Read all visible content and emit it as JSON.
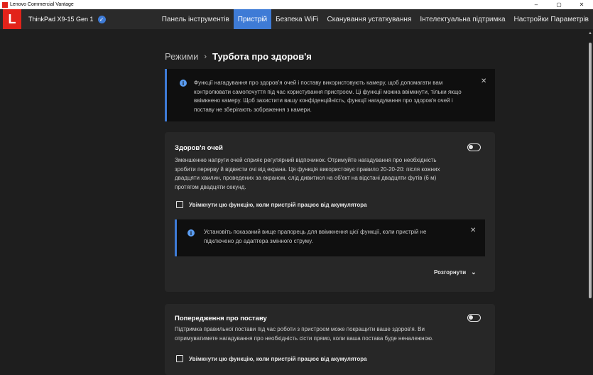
{
  "window": {
    "title": "Lenovo Commercial Vantage",
    "minimize": "–",
    "maximize": "▢",
    "close": "✕"
  },
  "appbar": {
    "logo": "L",
    "device_name": "ThinkPad X9-15 Gen 1",
    "verified": "✓",
    "tabs": [
      {
        "label": "Панель інструментів"
      },
      {
        "label": "Пристрій"
      },
      {
        "label": "Безпека WiFi"
      },
      {
        "label": "Сканування устаткування"
      },
      {
        "label": "Інтелектуальна підтримка"
      },
      {
        "label": "Настройки Параметрів"
      }
    ],
    "active_tab": "Пристрій"
  },
  "breadcrumb": {
    "parent": "Режими",
    "separator": "›",
    "current": "Турбота про здоров'я"
  },
  "notice": {
    "icon": "info-icon",
    "text": "Функції нагадування про здоров'я очей і поставу використовують камеру, щоб допомагати вам контролювати самопочуття під час користування пристроєм. Ці функції можна ввімкнути, тільки якщо ввімкнено камеру. Щоб захистити вашу конфіденційність, функції нагадування про здоров'я очей і поставу не зберігають зображення з камери.",
    "close": "✕"
  },
  "eye_health": {
    "title": "Здоров'я очей",
    "description": "Зменшенню напруги очей сприяє регулярний відпочинок. Отримуйте нагадування про необхідність зробити перерву й відвести очі від екрана. Ця функція використовує правило 20-20-20: після кожних двадцяти хвилин, проведених за екраном, слід дивитися на об'єкт на відстані двадцяти футів (6 м) протягом двадцяти секунд.",
    "toggle_on": false,
    "battery_checkbox": "Увімкнути цю функцію, коли пристрій працює від акумулятора",
    "battery_checked": false,
    "inner_notice": "Установіть показаний вище прапорець для ввімкнення цієї функції, коли пристрій не підключено до адаптера змінного струму.",
    "inner_close": "✕",
    "expand_label": "Розгорнути",
    "expand_icon": "⌄"
  },
  "posture": {
    "title": "Попередження про поставу",
    "description": "Підтримка правильної постави під час роботи з пристроєм може покращити ваше здоров'я. Ви отримуватимете нагадування про необхідність сісти прямо, коли ваша постава буде неналежною.",
    "toggle_on": false,
    "battery_checkbox": "Увімкнути цю функцію, коли пристрій працює від акумулятора",
    "battery_checked": false
  },
  "colors": {
    "accent": "#3e7bd6",
    "brand": "#e2231a",
    "background": "#1e1e1e",
    "card": "#272727"
  }
}
